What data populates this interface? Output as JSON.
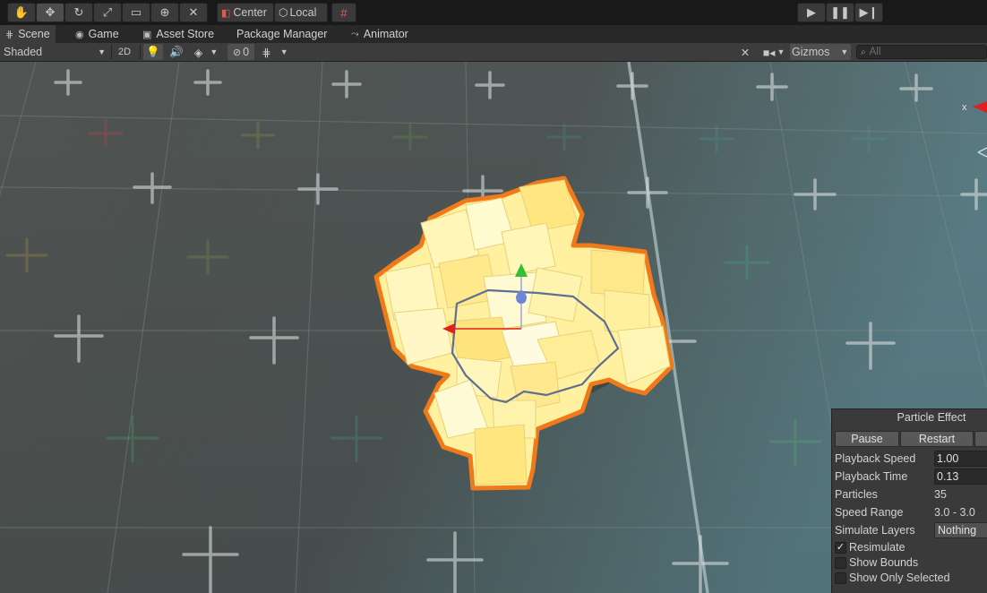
{
  "toolbar": {
    "tools": [
      "hand-tool",
      "move-tool",
      "rotate-tool",
      "scale-tool",
      "rect-tool",
      "transform-tool",
      "custom-tool"
    ],
    "pivot_label": "Center",
    "space_label": "Local",
    "play": "play",
    "pause": "pause",
    "step": "step"
  },
  "tabs": [
    {
      "label": "Scene",
      "icon": "grid-icon"
    },
    {
      "label": "Game",
      "icon": "gamepad-icon"
    },
    {
      "label": "Asset Store",
      "icon": "bag-icon"
    },
    {
      "label": "Package Manager",
      "icon": ""
    },
    {
      "label": "Animator",
      "icon": "animator-icon"
    }
  ],
  "scene_toolbar": {
    "shading_mode": "Shaded",
    "mode_2d": "2D",
    "hidden_count": "0",
    "gizmos_label": "Gizmos",
    "search_placeholder": "All"
  },
  "axis_gizmo_label": "x",
  "particle_panel": {
    "title": "Particle Effect",
    "pause_label": "Pause",
    "restart_label": "Restart",
    "playback_speed_label": "Playback Speed",
    "playback_speed_value": "1.00",
    "playback_time_label": "Playback Time",
    "playback_time_value": "0.13",
    "particles_label": "Particles",
    "particles_value": "35",
    "speed_range_label": "Speed Range",
    "speed_range_value": "3.0 - 3.0",
    "simulate_layers_label": "Simulate Layers",
    "simulate_layers_value": "Nothing",
    "resimulate_label": "Resimulate",
    "resimulate_checked": true,
    "show_bounds_label": "Show Bounds",
    "show_bounds_checked": false,
    "show_only_selected_label": "Show Only Selected",
    "show_only_selected_checked": false
  },
  "colors": {
    "particle_fill": "#fff3a8",
    "selection_outline": "#f07a1a",
    "gizmo_red": "#e02020",
    "gizmo_green": "#30c030",
    "gizmo_blue": "#6f86d6"
  }
}
